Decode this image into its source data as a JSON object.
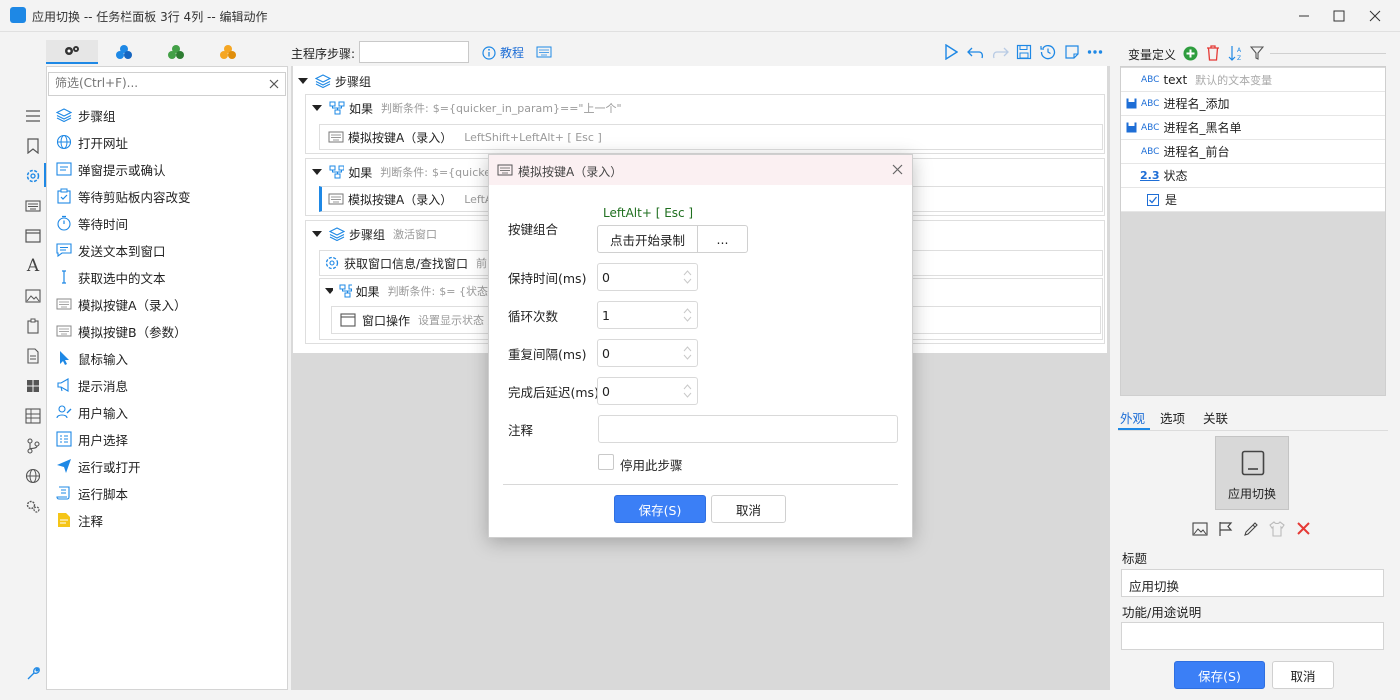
{
  "window": {
    "title": "应用切换 -- 任务栏面板 3行 4列 -- 编辑动作",
    "accent": "#1e88e5"
  },
  "left_panel": {
    "tab_icons": [
      "gears-icon",
      "blocks-blue-icon",
      "blocks-green-icon",
      "blocks-orange-icon"
    ],
    "filter_placeholder": "筛选(Ctrl+F)...",
    "items": [
      {
        "label": "步骤组",
        "icon": "layers-icon"
      },
      {
        "label": "打开网址",
        "icon": "globe-icon"
      },
      {
        "label": "弹窗提示或确认",
        "icon": "popup-icon"
      },
      {
        "label": "等待剪贴板内容改变",
        "icon": "clipboard-check-icon"
      },
      {
        "label": "等待时间",
        "icon": "timer-icon"
      },
      {
        "label": "发送文本到窗口",
        "icon": "message-icon"
      },
      {
        "label": "获取选中的文本",
        "icon": "text-cursor-icon"
      },
      {
        "label": "模拟按键A（录入）",
        "icon": "keyboard-icon"
      },
      {
        "label": "模拟按键B（参数）",
        "icon": "keyboard-icon"
      },
      {
        "label": "鼠标输入",
        "icon": "mouse-pointer-icon"
      },
      {
        "label": "提示消息",
        "icon": "megaphone-icon"
      },
      {
        "label": "用户输入",
        "icon": "user-edit-icon"
      },
      {
        "label": "用户选择",
        "icon": "list-select-icon"
      },
      {
        "label": "运行或打开",
        "icon": "paper-plane-icon"
      },
      {
        "label": "运行脚本",
        "icon": "script-icon"
      },
      {
        "label": "注释",
        "icon": "note-icon"
      }
    ]
  },
  "toolbar": {
    "main_steps_label": "主程序步骤:",
    "main_steps_value": "",
    "tutorial_label": "教程"
  },
  "tree": {
    "group1": {
      "label": "步骤组"
    },
    "if1": {
      "label": "如果",
      "cond_prefix": "判断条件:",
      "cond": "$={quicker_in_param}==\"上一个\""
    },
    "key1": {
      "label": "模拟按键A（录入）",
      "detail": "LeftShift+LeftAlt+ [ Esc ]"
    },
    "if2": {
      "label": "如果",
      "cond_prefix": "判断条件:",
      "cond": "$={quicke"
    },
    "key2": {
      "label": "模拟按键A（录入）",
      "detail": "LeftAl"
    },
    "group2": {
      "label": "步骤组",
      "detail": "激活窗口"
    },
    "getwin": {
      "label": "获取窗口信息/查找窗口",
      "detail": "前"
    },
    "if3": {
      "label": "如果",
      "cond_prefix": "判断条件:",
      "cond": "$= {状态"
    },
    "winop": {
      "label": "窗口操作",
      "detail": "设置显示状态 显"
    }
  },
  "dialog": {
    "title": "模拟按键A（录入）",
    "key_combo_label": "按键组合",
    "key_combo_value": "LeftAlt+ [ Esc ]",
    "record_button": "点击开始录制",
    "more_button": "...",
    "hold_label": "保持时间(ms)",
    "hold_value": "0",
    "loop_label": "循环次数",
    "loop_value": "1",
    "interval_label": "重复间隔(ms)",
    "interval_value": "0",
    "delay_label": "完成后延迟(ms)",
    "delay_value": "0",
    "comment_label": "注释",
    "comment_value": "",
    "disable_label": "停用此步骤",
    "save_button": "保存(S)",
    "cancel_button": "取消"
  },
  "right_panel": {
    "vars_title": "变量定义",
    "variables": [
      {
        "type": "ABC",
        "name": "text",
        "desc": "默认的文本变量",
        "saved": false
      },
      {
        "type": "ABC",
        "name": "进程名_添加",
        "desc": "",
        "saved": true
      },
      {
        "type": "ABC",
        "name": "进程名_黑名单",
        "desc": "",
        "saved": true
      },
      {
        "type": "ABC",
        "name": "进程名_前台",
        "desc": "",
        "saved": false
      },
      {
        "type": "2.3",
        "name": "状态",
        "desc": "",
        "saved": false
      },
      {
        "type": "bool",
        "name": "是",
        "desc": "",
        "saved": false
      }
    ],
    "tabs": [
      "外观",
      "选项",
      "关联"
    ],
    "preview_label": "应用切换",
    "title_label": "标题",
    "title_value": "应用切换",
    "desc_label": "功能/用途说明",
    "desc_value": "",
    "save_button": "保存(S)",
    "cancel_button": "取消"
  }
}
